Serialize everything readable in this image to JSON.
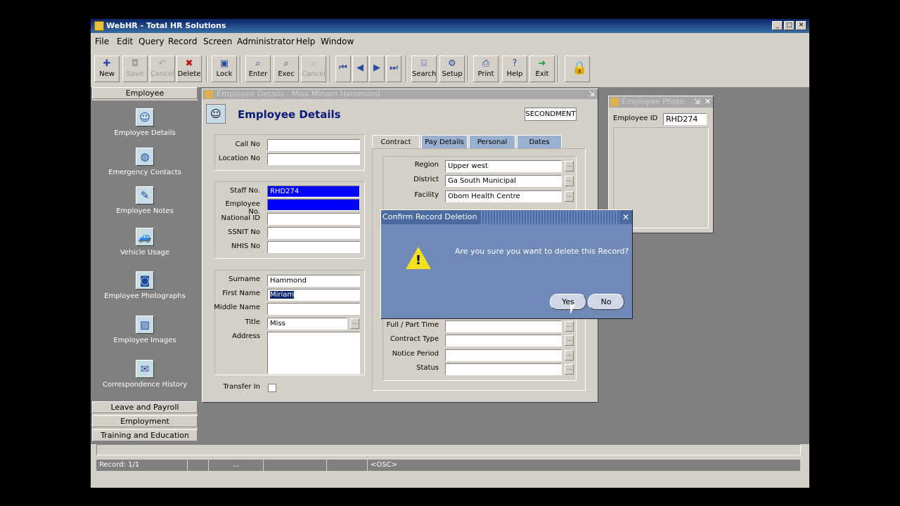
{
  "window": {
    "title": "WebHR - Total HR Solutions"
  },
  "menu": [
    "File",
    "Edit",
    "Query",
    "Record",
    "Screen",
    "Administrator",
    "Help",
    "Window"
  ],
  "toolbar": {
    "new": "New",
    "save": "Save",
    "cancel1": "Cancel",
    "delete": "Delete",
    "lock": "Lock",
    "enter": "Enter",
    "exec": "Exec",
    "cancel2": "Cancel",
    "search": "Search",
    "setup": "Setup",
    "print": "Print",
    "help": "Help",
    "exit": "Exit"
  },
  "sidebar": {
    "header": "Employee",
    "items": [
      "Employee Details",
      "Emergency Contacts",
      "Employee Notes",
      "Vehicle Usage",
      "Employee Photographs",
      "Employee Images",
      "Correspondence History"
    ],
    "sections": [
      "Leave and Payroll",
      "Employment",
      "Training and Education"
    ]
  },
  "form": {
    "window_title": "Employee Details - Miss Miriam Hammond",
    "heading": "Employee Details",
    "secondment": "SECONDMENT",
    "labels": {
      "call_no": "Call No",
      "location_no": "Location No",
      "staff_no": "Staff No.",
      "employee_no": "Employee No.",
      "national_id": "National ID",
      "ssnit_no": "SSNIT No",
      "nhis_no": "NHIS No",
      "surname": "Surname",
      "first_name": "First Name",
      "middle_name": "Middle Name",
      "title": "Title",
      "address": "Address",
      "transfer_in": "Transfer In"
    },
    "values": {
      "staff_no": "RHD274",
      "surname": "Hammond",
      "first_name": "Miriam",
      "title": "Miss"
    },
    "tabs": [
      "Contract",
      "Pay Details",
      "Personal",
      "Dates"
    ],
    "contract": {
      "labels": {
        "region": "Region",
        "district": "District",
        "facility": "Facility",
        "full_part": "Full / Part Time",
        "contract_type": "Contract Type",
        "notice_period": "Notice Period",
        "status": "Status"
      },
      "values": {
        "region": "Upper west",
        "district": "Ga South Municipal",
        "facility": "Obom Health Centre"
      }
    }
  },
  "photo": {
    "title": "Employee Photo",
    "id_label": "Employee ID",
    "id_value": "RHD274"
  },
  "dialog": {
    "title": "Confirm Record Deletion",
    "message": "Are you sure you want to delete this Record?",
    "yes": "Yes",
    "no": "No"
  },
  "status": {
    "record": "Record: 1/1",
    "dots": "...",
    "mode": "<OSC>"
  },
  "colors": {
    "titlebar": "#0a246a",
    "mdi_bg": "#808080",
    "selected_field": "#0000ff",
    "dialog_bg": "#708ab8",
    "heading": "#0a1a7a"
  }
}
